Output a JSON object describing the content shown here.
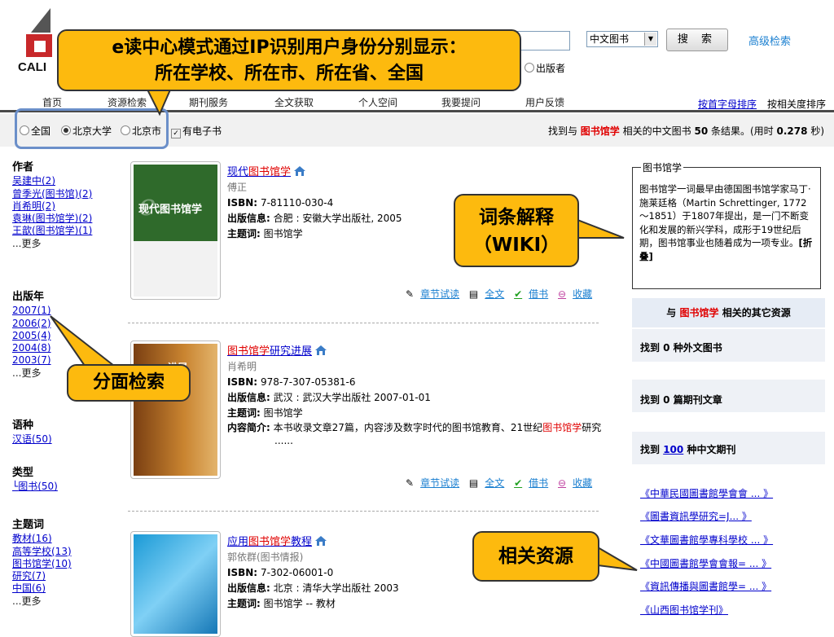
{
  "logo": {
    "text": "CALI"
  },
  "search": {
    "scope_value": "中文图书",
    "button_label": "搜 索",
    "advanced_link": "高级检索",
    "publisher_radio": "出版者"
  },
  "nav": {
    "items": [
      "首页",
      "资源检索",
      "期刊服务",
      "全文获取",
      "个人空间",
      "我要提问",
      "用户反馈"
    ],
    "sort_by_letter": "按首字母排序",
    "sort_by_relevance": "按相关度排序"
  },
  "filter": {
    "options": [
      "全国",
      "北京大学",
      "北京市"
    ],
    "selected": "北京大学",
    "ebook_label": "有电子书",
    "result_prefix": "找到与",
    "result_keyword": "图书馆学",
    "result_mid": "相关的中文图书",
    "result_count": "50",
    "result_suffix": "条结果。(用时",
    "result_time": "0.278",
    "result_end": "秒)"
  },
  "facets": [
    {
      "head": "作者",
      "items": [
        "吴建中(2)",
        "曾季光(图书馆)(2)",
        "肖希明(2)",
        "袁琳(图书馆学)(2)",
        "王歆(图书馆学)(1)"
      ],
      "more": "...更多"
    },
    {
      "head": "出版年",
      "items": [
        "2007(1)",
        "2006(2)",
        "2005(4)",
        "2004(8)",
        "2003(7)"
      ],
      "more": "...更多"
    },
    {
      "head": "语种",
      "items": [
        "汉语(50)"
      ],
      "more": ""
    },
    {
      "head": "类型",
      "items": [
        "图书(50)"
      ],
      "more": ""
    },
    {
      "head": "主题词",
      "items": [
        "教材(16)",
        "高等学校(13)",
        "图书馆学(10)",
        "研究(7)",
        "中国(6)"
      ],
      "more": "...更多"
    }
  ],
  "results": [
    {
      "title_pre": "现代",
      "title_hl": "图书馆学",
      "title_post": "",
      "author": "傅正",
      "isbn_label": "ISBN:",
      "isbn": "7-81110-030-4",
      "pub_label": "出版信息:",
      "pub": "合肥 : 安徽大学出版社, 2005",
      "subject_label": "主题词:",
      "subject": "图书馆学",
      "cover_text": "现代图书馆学",
      "actions": [
        "章节试读",
        "全文",
        "借书",
        "收藏"
      ]
    },
    {
      "title_pre": "",
      "title_hl": "图书馆学",
      "title_post": "研究进展",
      "author": "肖希明",
      "isbn_label": "ISBN:",
      "isbn": "978-7-307-05381-6",
      "pub_label": "出版信息:",
      "pub": "武汉 : 武汉大学出版社 2007-01-01",
      "subject_label": "主题词:",
      "subject": "图书馆学",
      "summary_label": "内容简介:",
      "summary_pre": "本书收录文章27篇，内容涉及数字时代的图书馆教育、21世纪",
      "summary_hl": "图书馆学",
      "summary_post": "研究 ......",
      "cover_text": "进展",
      "actions": [
        "章节试读",
        "全文",
        "借书",
        "收藏"
      ]
    },
    {
      "title_pre": "应用",
      "title_hl": "图书馆学",
      "title_post": "教程",
      "author": "郭依群(图书情报)",
      "isbn_label": "ISBN:",
      "isbn": "7-302-06001-0",
      "pub_label": "出版信息:",
      "pub": "北京 : 清华大学出版社 2003",
      "subject_label": "主题词:",
      "subject": "图书馆学 -- 教材",
      "cover_text": "",
      "actions": []
    }
  ],
  "wiki": {
    "title": "图书馆学",
    "body": "图书馆学一词最早由德国图书馆学家马丁·施莱廷格（Martin Schrettinger, 1772～1851）于1807年提出，是一门不断变化和发展的新兴学科，成形于19世纪后期，图书馆事业也随着成为一项专业。",
    "fold": "[折叠]"
  },
  "related": {
    "title_pre": "与",
    "title_hl": "图书馆学",
    "title_post": "相关的其它资源",
    "foreign": "找到 0 种外文图书",
    "articles": "找到 0 篇期刊文章",
    "journals_pre": "找到",
    "journals_count": "100",
    "journals_post": "种中文期刊",
    "journal_list": [
      "《中華民國圖書館學會會 ... 》",
      "《圖書資訊學研究=J... 》",
      "《文華圖書館學專科學校 ... 》",
      "《中國圖書館學會會報= ... 》",
      "《資訊傳播與圖書館學= ... 》",
      "《山西图书馆学刊》"
    ]
  },
  "callouts": {
    "top_line1": "e读中心模式通过IP识别用户身份分别显示：",
    "top_line2": "所在学校、所在市、所在省、全国",
    "wiki_line1": "词条解释",
    "wiki_line2": "（WIKI）",
    "facet": "分面检索",
    "related": "相关资源"
  },
  "colors": {
    "callout": "#fdba0e",
    "highlight": "#e00000",
    "link": "#0000cc",
    "filter_box": "#6b8fc9"
  }
}
